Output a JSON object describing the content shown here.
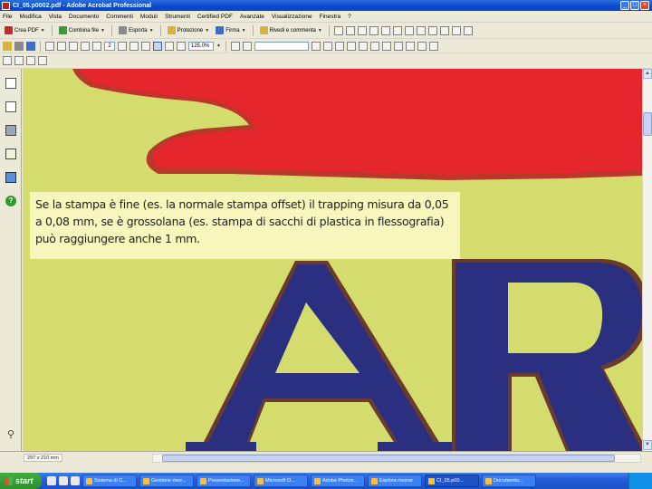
{
  "window": {
    "title": "CI_05.p0002.pdf - Adobe Acrobat Professional",
    "controls": [
      "_",
      "□",
      "×"
    ]
  },
  "menu": [
    "File",
    "Modifica",
    "Vista",
    "Documento",
    "Commenti",
    "Moduli",
    "Strumenti",
    "Certified PDF",
    "Avanzate",
    "Visualizzazione",
    "Finestra",
    "?"
  ],
  "toolbar": {
    "create_pdf": "Crea PDF",
    "combine": "Combina file",
    "export": "Esporta",
    "secure": "Protezione",
    "sign": "Firma",
    "review": "Rivedi e commenta",
    "page_current": "2",
    "zoom": "125,0%"
  },
  "nav_panel": {
    "icons": [
      "pages-icon",
      "signatures-icon",
      "layers-icon",
      "comments-pen-icon",
      "model-tree-icon",
      "help-icon",
      "attachments-icon",
      "comments-icon"
    ]
  },
  "document": {
    "callout_text": "Se la stampa è fine (es. la normale stampa offset) il trapping misura da 0,05 a 0,08 mm, se è grossolana (es. stampa di sacchi di plastica in flessografia) può raggiungere anche 1 mm.",
    "art_letters": "AR",
    "colors": {
      "background": "#d3dc6c",
      "red_shape": "#e5262c",
      "red_trap_outline": "#b8392a",
      "letters": "#2a2f80",
      "letters_trap": "#6a3a2f",
      "callout_bg": "#f7f6bc"
    }
  },
  "status": {
    "page_size": "297 x 210 mm"
  },
  "taskbar": {
    "start": "start",
    "tasks": [
      "Sistema di C...",
      "Gestione risor...",
      "Presentazione...",
      "Microsoft O...",
      "Adobe Photos...",
      "Esplora risorse",
      "CI_05.p00...",
      "Documento..."
    ],
    "active_task_index": 6
  }
}
